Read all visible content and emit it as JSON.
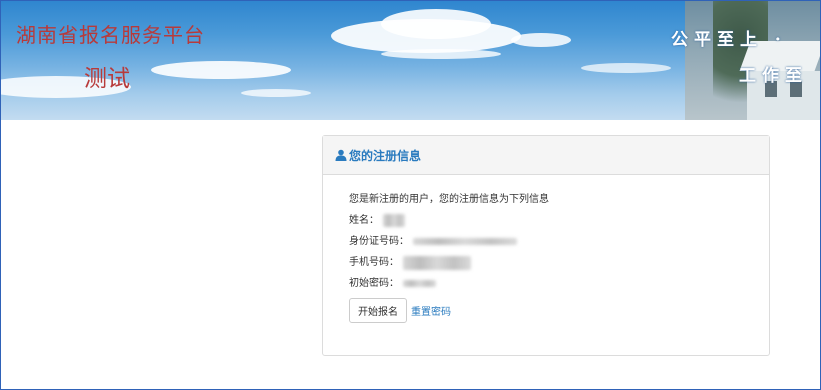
{
  "banner": {
    "site_title": "湖南省报名服务平台",
    "site_subtitle": "测试",
    "slogan_line1": "公平至上 ·",
    "slogan_line2": "工作至"
  },
  "panel": {
    "title": "您的注册信息",
    "title_icon": "user-icon",
    "intro": "您是新注册的用户，您的注册信息为下列信息",
    "fields": [
      {
        "label": "姓名："
      },
      {
        "label": "身份证号码："
      },
      {
        "label": "手机号码："
      },
      {
        "label": "初始密码："
      }
    ],
    "start_button": "开始报名",
    "reset_link": "重置密码"
  },
  "colors": {
    "frame_border": "#2f62b8",
    "title_red": "#b83a3a",
    "link_blue": "#2a7bbf",
    "sky_top": "#2f86cf"
  }
}
